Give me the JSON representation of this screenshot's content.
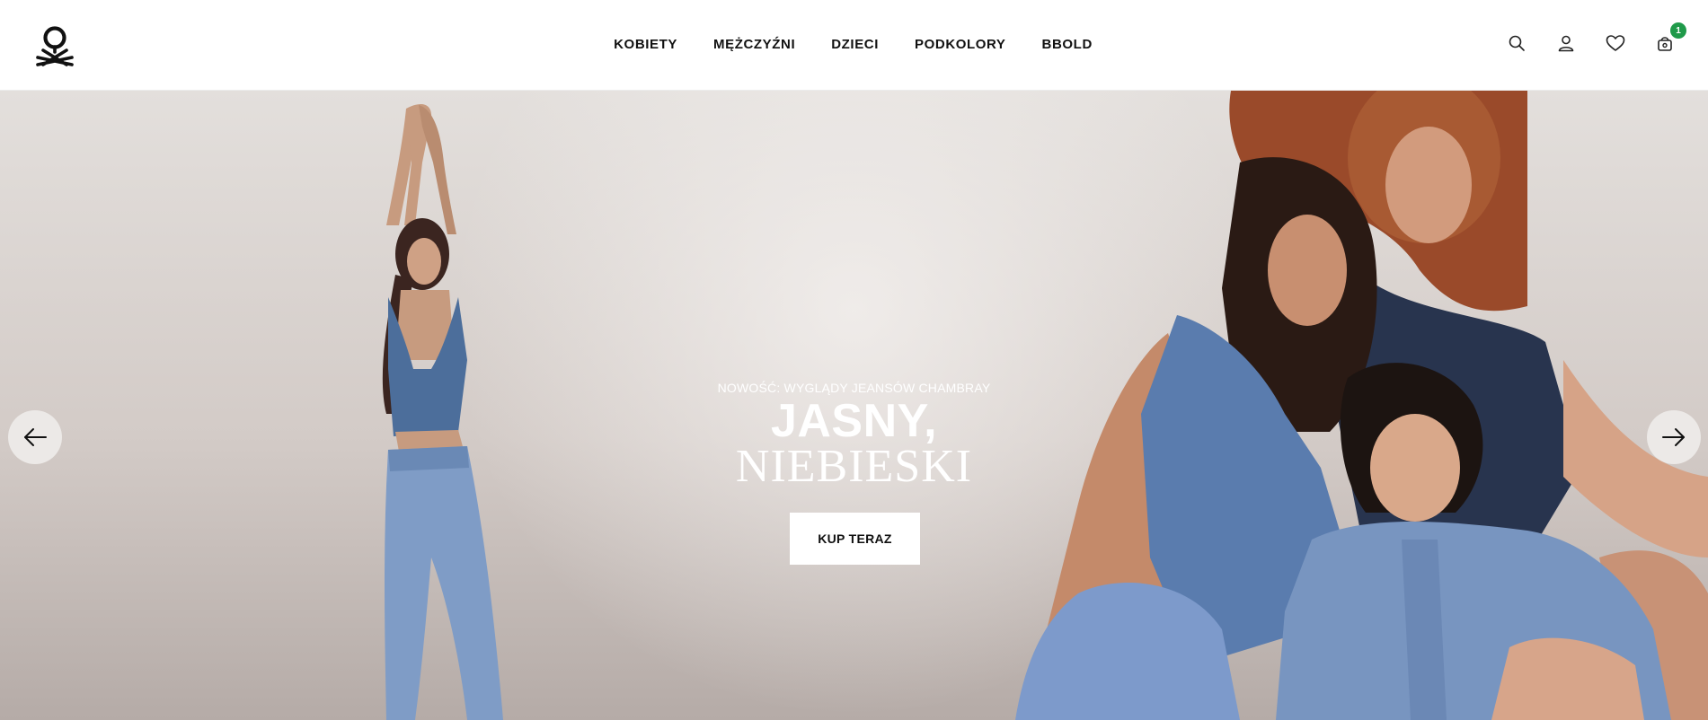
{
  "header": {
    "logo_icon": "benetton-knot-logo",
    "nav": [
      {
        "label": "KOBIETY"
      },
      {
        "label": "MĘŻCZYŹNI"
      },
      {
        "label": "DZIECI"
      },
      {
        "label": "PODKOLORY"
      },
      {
        "label": "BBOLD"
      }
    ],
    "icons": [
      "search-icon",
      "user-icon",
      "heart-icon",
      "cart-icon"
    ],
    "cart_count": "1",
    "badge_color": "#1f9a4a"
  },
  "hero": {
    "eyebrow": "NOWOŚĆ: WYGLĄDY JEANSÓW CHAMBRAY",
    "headline_line1": "JASNY,",
    "headline_line2": "NIEBIESKI",
    "cta_label": "KUP TERAZ",
    "prev_icon": "arrow-left-icon",
    "next_icon": "arrow-right-icon",
    "colors": {
      "background": "#dcd6d2",
      "denim": "#6c8bb8",
      "text": "#ffffff"
    }
  }
}
